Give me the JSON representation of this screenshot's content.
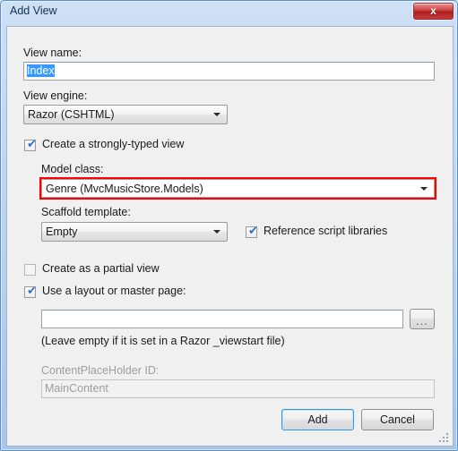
{
  "window": {
    "title": "Add View",
    "close_label": "✖",
    "close_glyph": "x"
  },
  "form": {
    "view_name_label": "View name:",
    "view_name_value": "Index",
    "view_engine_label": "View engine:",
    "view_engine_value": "Razor (CSHTML)",
    "strongly_typed_label": "Create a strongly-typed view",
    "strongly_typed_checked": true,
    "model_class_label": "Model class:",
    "model_class_value": "Genre (MvcMusicStore.Models)",
    "scaffold_label": "Scaffold template:",
    "scaffold_value": "Empty",
    "reference_scripts_label": "Reference script libraries",
    "reference_scripts_checked": true,
    "partial_view_label": "Create as a partial view",
    "partial_view_checked": false,
    "layout_page_label": "Use a layout or master page:",
    "layout_page_checked": true,
    "layout_path_value": "",
    "browse_label": "...",
    "layout_hint": "(Leave empty if it is set in a Razor _viewstart file)",
    "content_placeholder_label": "ContentPlaceHolder ID:",
    "content_placeholder_value": "MainContent"
  },
  "buttons": {
    "add_label": "Add",
    "cancel_label": "Cancel"
  },
  "checkmark": "✔",
  "colors": {
    "accent_red": "#ff0000",
    "selection_blue": "#3399ff",
    "frame_blue": "#5c8ecb",
    "dialog_bg": "#f0f0f0"
  }
}
